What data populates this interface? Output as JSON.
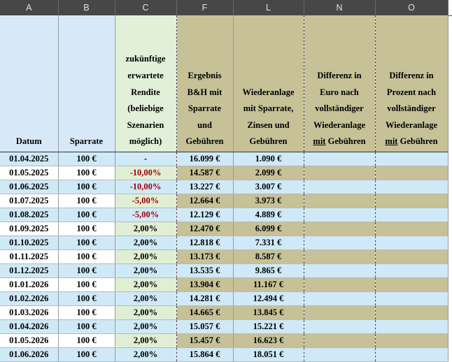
{
  "columns": [
    "A",
    "B",
    "C",
    "F",
    "L",
    "N",
    "O"
  ],
  "headers": {
    "datum": "Datum",
    "sparrate": "Sparrate",
    "rendite": [
      "zukünftige",
      "erwartete",
      "Rendite",
      "(beliebige",
      "Szenarien",
      "möglich)"
    ],
    "ergebnis": [
      "Ergebnis",
      "B&H mit",
      "Sparrate",
      "und",
      "Gebühren"
    ],
    "wiederanlage": [
      "Wiederanlage",
      "mit Sparrate,",
      "Zinsen und",
      "Gebühren"
    ],
    "diff_euro": [
      "Differenz in",
      "Euro nach",
      "vollständiger",
      "Wiederanlage"
    ],
    "diff_euro_last_prefix": "mit",
    "diff_euro_last_suffix": " Gebühren",
    "diff_pct": [
      "Differenz in",
      "Prozent nach",
      "vollständiger",
      "Wiederanlage"
    ],
    "diff_pct_last_prefix": "mit",
    "diff_pct_last_suffix": " Gebühren"
  },
  "rows": [
    {
      "datum": "01.04.2025",
      "sparrate": "100 €",
      "rendite": "-",
      "ergebnis": "16.099 €",
      "wiederanlage": "1.090 €",
      "diff_euro": "",
      "diff_pct": ""
    },
    {
      "datum": "01.05.2025",
      "sparrate": "100 €",
      "rendite": "-10,00%",
      "ergebnis": "14.587 €",
      "wiederanlage": "2.099 €",
      "diff_euro": "",
      "diff_pct": ""
    },
    {
      "datum": "01.06.2025",
      "sparrate": "100 €",
      "rendite": "-10,00%",
      "ergebnis": "13.227 €",
      "wiederanlage": "3.007 €",
      "diff_euro": "",
      "diff_pct": ""
    },
    {
      "datum": "01.07.2025",
      "sparrate": "100 €",
      "rendite": "-5,00%",
      "ergebnis": "12.664 €",
      "wiederanlage": "3.973 €",
      "diff_euro": "",
      "diff_pct": ""
    },
    {
      "datum": "01.08.2025",
      "sparrate": "100 €",
      "rendite": "-5,00%",
      "ergebnis": "12.129 €",
      "wiederanlage": "4.889 €",
      "diff_euro": "",
      "diff_pct": ""
    },
    {
      "datum": "01.09.2025",
      "sparrate": "100 €",
      "rendite": "2,00%",
      "ergebnis": "12.470 €",
      "wiederanlage": "6.099 €",
      "diff_euro": "",
      "diff_pct": ""
    },
    {
      "datum": "01.10.2025",
      "sparrate": "100 €",
      "rendite": "2,00%",
      "ergebnis": "12.818 €",
      "wiederanlage": "7.331 €",
      "diff_euro": "",
      "diff_pct": ""
    },
    {
      "datum": "01.11.2025",
      "sparrate": "100 €",
      "rendite": "2,00%",
      "ergebnis": "13.173 €",
      "wiederanlage": "8.587 €",
      "diff_euro": "",
      "diff_pct": ""
    },
    {
      "datum": "01.12.2025",
      "sparrate": "100 €",
      "rendite": "2,00%",
      "ergebnis": "13.535 €",
      "wiederanlage": "9.865 €",
      "diff_euro": "",
      "diff_pct": ""
    },
    {
      "datum": "01.01.2026",
      "sparrate": "100 €",
      "rendite": "2,00%",
      "ergebnis": "13.904 €",
      "wiederanlage": "11.167 €",
      "diff_euro": "",
      "diff_pct": ""
    },
    {
      "datum": "01.02.2026",
      "sparrate": "100 €",
      "rendite": "2,00%",
      "ergebnis": "14.281 €",
      "wiederanlage": "12.494 €",
      "diff_euro": "",
      "diff_pct": ""
    },
    {
      "datum": "01.03.2026",
      "sparrate": "100 €",
      "rendite": "2,00%",
      "ergebnis": "14.665 €",
      "wiederanlage": "13.845 €",
      "diff_euro": "",
      "diff_pct": ""
    },
    {
      "datum": "01.04.2026",
      "sparrate": "100 €",
      "rendite": "2,00%",
      "ergebnis": "15.057 €",
      "wiederanlage": "15.221 €",
      "diff_euro": "",
      "diff_pct": ""
    },
    {
      "datum": "01.05.2026",
      "sparrate": "100 €",
      "rendite": "2,00%",
      "ergebnis": "15.457 €",
      "wiederanlage": "16.623 €",
      "diff_euro": "",
      "diff_pct": ""
    },
    {
      "datum": "01.06.2026",
      "sparrate": "100 €",
      "rendite": "2,00%",
      "ergebnis": "15.864 €",
      "wiederanlage": "18.051 €",
      "diff_euro": "",
      "diff_pct": ""
    }
  ],
  "colors": {
    "header_bar": "#474747",
    "blue_fill": "#cfe9f7",
    "olive_fill": "#c6c197",
    "green_fill": "#e0efd4",
    "negative_text": "#9c0006"
  }
}
